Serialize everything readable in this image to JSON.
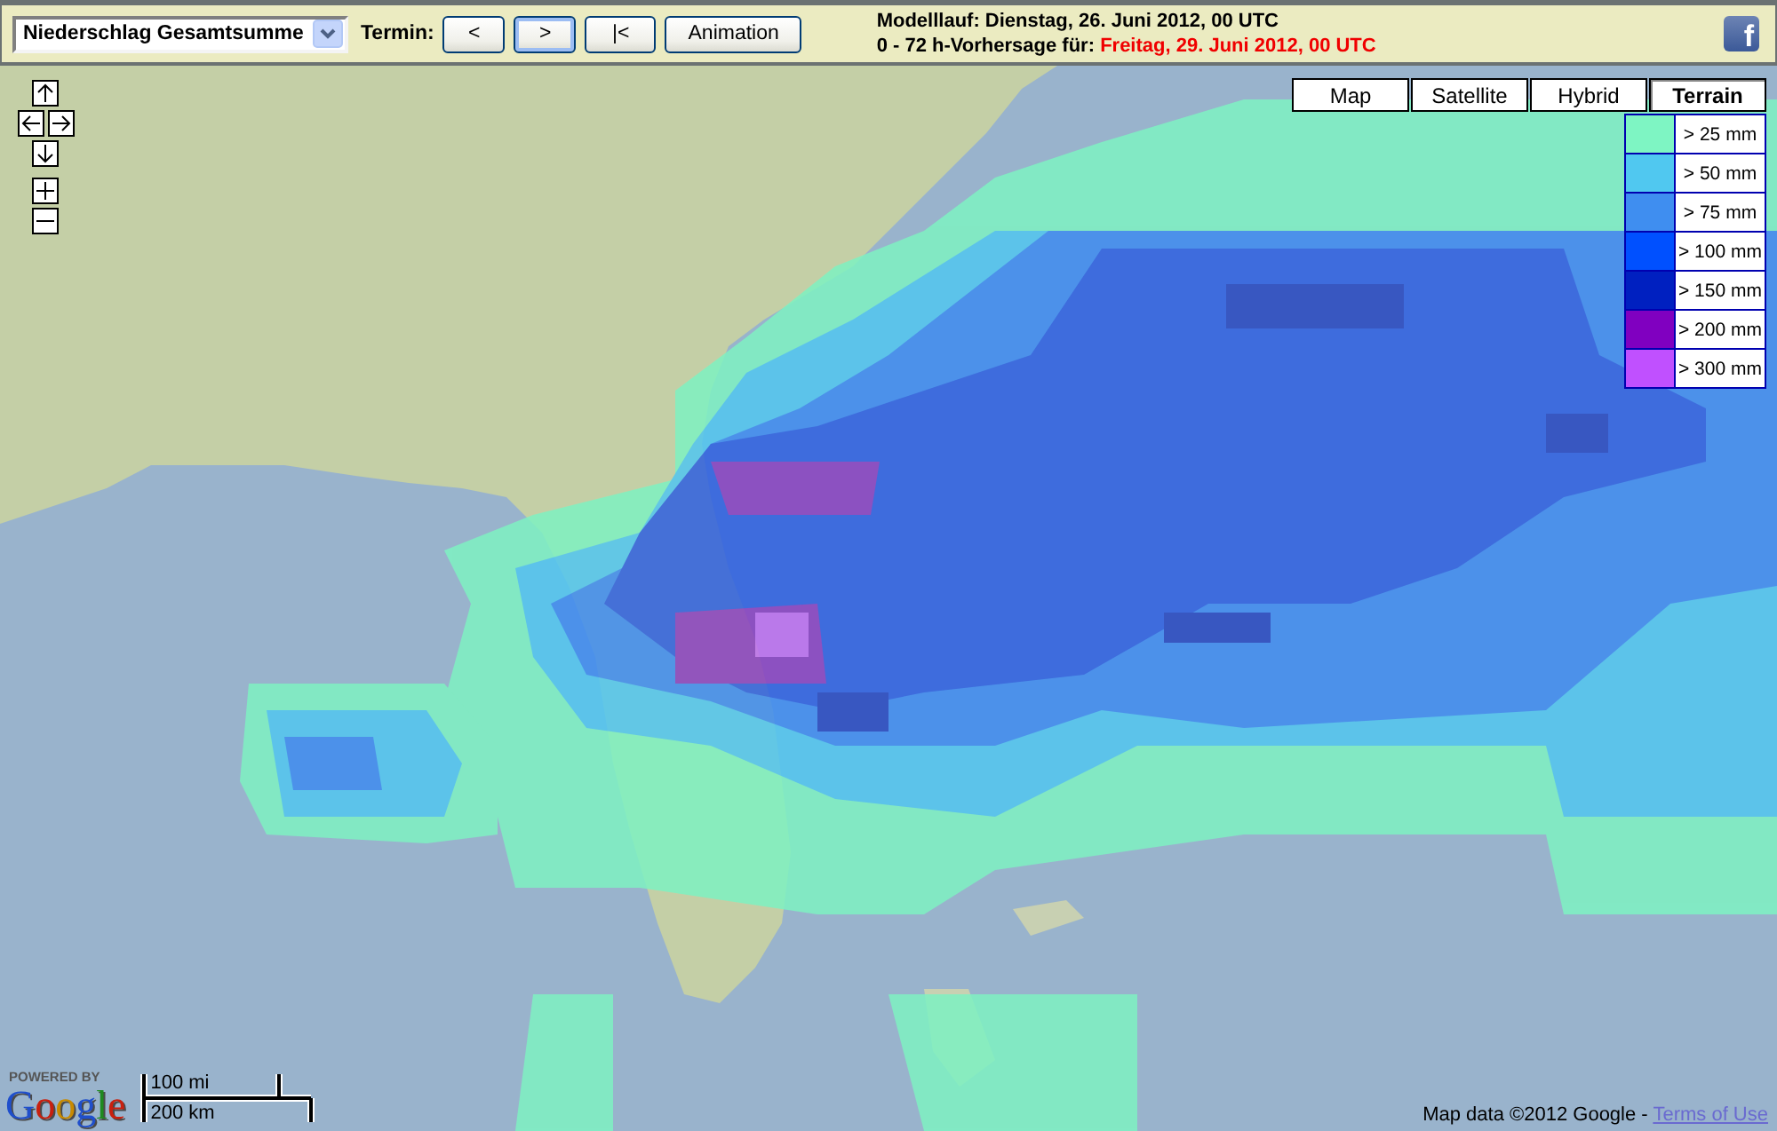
{
  "toolbar": {
    "product_select": {
      "value": "Niederschlag Gesamtsumme"
    },
    "termin_label": "Termin:",
    "buttons": [
      {
        "label": "<",
        "focused": false
      },
      {
        "label": ">",
        "focused": true
      },
      {
        "label": "|<",
        "focused": false
      },
      {
        "label": "Animation",
        "focused": false
      }
    ],
    "model_run": "Modelllauf: Dienstag, 26. Juni 2012, 00 UTC",
    "forecast": {
      "label": "0 - 72 h-Vorhersage für:",
      "time": "Freitag, 29. Juni 2012, 00 UTC"
    },
    "facebook_button": {
      "label": "f"
    }
  },
  "map": {
    "map_types": [
      {
        "label": "Map",
        "selected": false
      },
      {
        "label": "Satellite",
        "selected": false
      },
      {
        "label": "Hybrid",
        "selected": false
      },
      {
        "label": "Terrain",
        "selected": true
      }
    ],
    "legend": [
      {
        "label": "> 25 mm",
        "color": "#7ef5c3"
      },
      {
        "label": "> 50 mm",
        "color": "#50c8f0"
      },
      {
        "label": "> 75 mm",
        "color": "#3f8ef0"
      },
      {
        "label": "> 100 mm",
        "color": "#0050ff"
      },
      {
        "label": "> 150 mm",
        "color": "#0020c0"
      },
      {
        "label": "> 200 mm",
        "color": "#8000c0"
      },
      {
        "label": "> 300 mm",
        "color": "#c050ff"
      }
    ],
    "branding": {
      "powered_by": "POWERED BY",
      "logo": "Google"
    },
    "scale": {
      "imperial": "100 mi",
      "metric": "200 km"
    },
    "attribution": {
      "text": "Map data ©2012 Google -",
      "link": "Terms of Use"
    }
  }
}
